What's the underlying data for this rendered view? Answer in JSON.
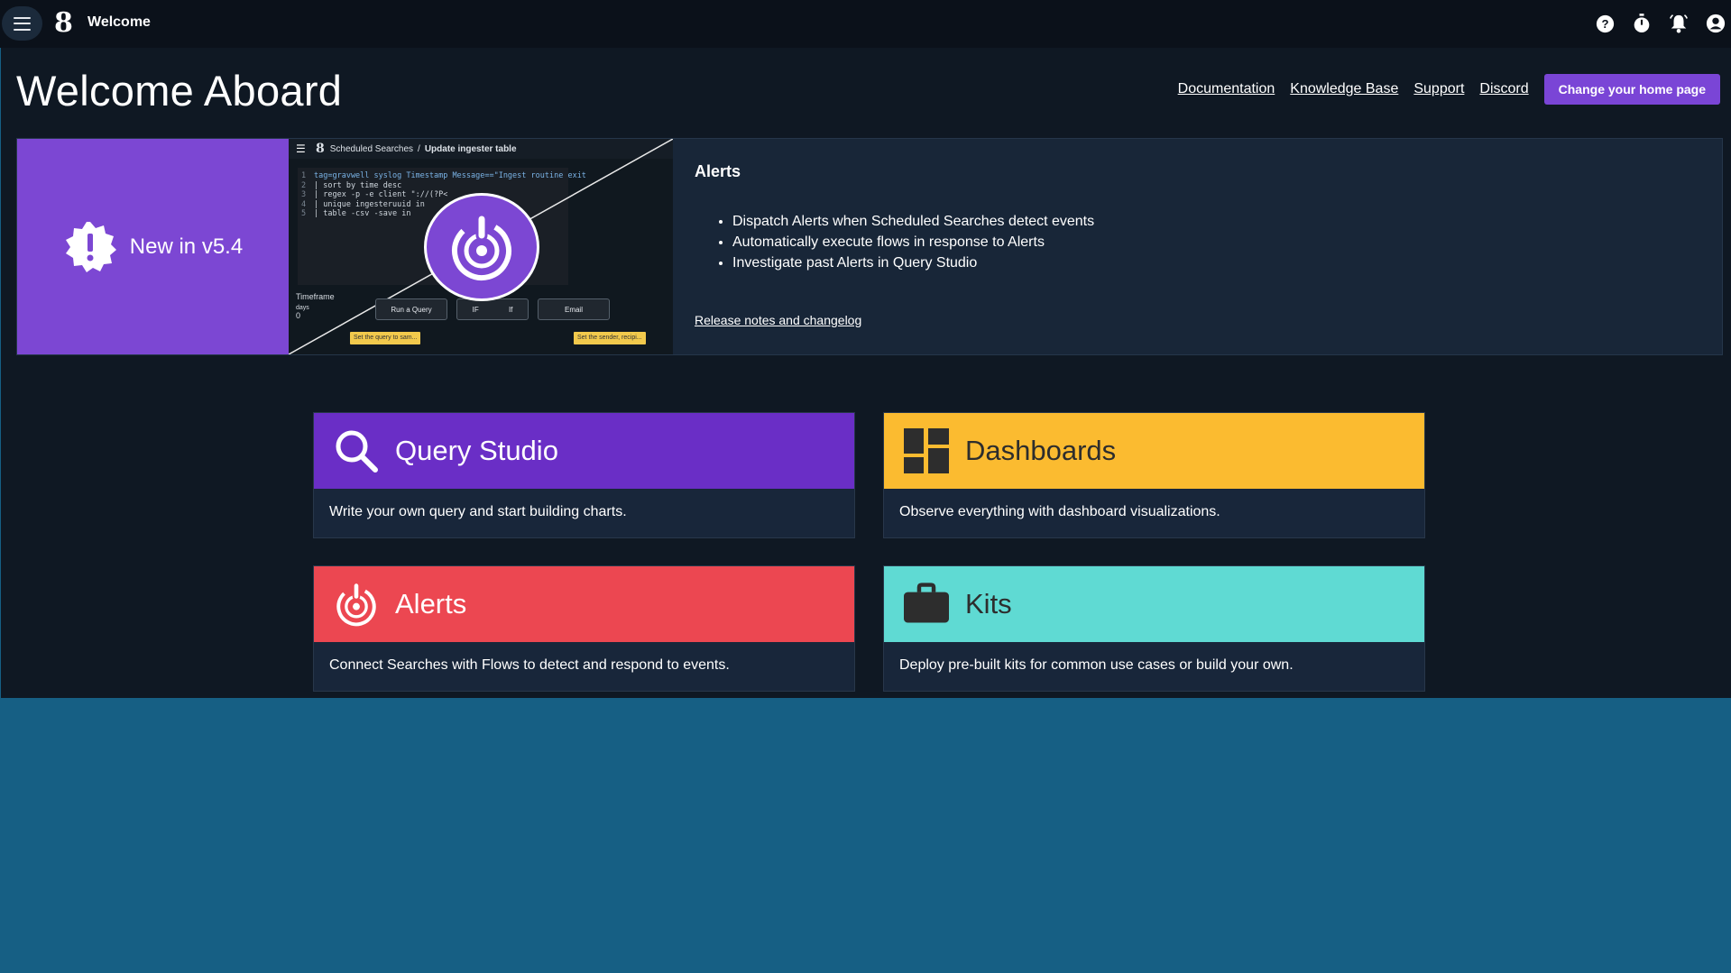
{
  "topbar": {
    "app_title": "Welcome",
    "logo_glyph": "8",
    "icons": [
      "help-icon",
      "timer-icon",
      "notifications-icon",
      "account-icon"
    ]
  },
  "header": {
    "title": "Welcome Aboard",
    "links": [
      "Documentation",
      "Knowledge Base",
      "Support",
      "Discord"
    ],
    "home_button": "Change your home page"
  },
  "banner": {
    "new_label": "New in v5.4",
    "preview": {
      "breadcrumb_parent": "Scheduled Searches",
      "breadcrumb_sep": "/",
      "breadcrumb_current": "Update ingester table",
      "code_lines": [
        "tag=gravwell syslog Timestamp Message==\"Ingest routine exit",
        "| sort by time desc",
        "| regex -p -e client \"://(?P<",
        "| unique ingesteruuid in",
        "| table -csv -save in"
      ],
      "line_numbers": [
        "1",
        "2",
        "3",
        "4",
        "5"
      ],
      "timeframe_label": "Timeframe",
      "days_label": "days",
      "days_value": "0",
      "flow_nodes": [
        "Run a Query",
        "IF",
        "Email"
      ],
      "flow_if_sub": "If",
      "note_left": "Set the query to sam...",
      "note_right": "Set the sender, recipi..."
    },
    "heading": "Alerts",
    "bullets": [
      "Dispatch Alerts when Scheduled Searches detect events",
      "Automatically execute flows in response to Alerts",
      "Investigate past Alerts in Query Studio"
    ],
    "release_link": "Release notes and changelog"
  },
  "cards": [
    {
      "title": "Query Studio",
      "description": "Write your own query and start building charts.",
      "color": "#6a2ec6",
      "icon": "search-icon"
    },
    {
      "title": "Dashboards",
      "description": "Observe everything with dashboard visualizations.",
      "color": "#fbbb30",
      "icon": "dashboard-icon"
    },
    {
      "title": "Alerts",
      "description": "Connect Searches with Flows to detect and respond to events.",
      "color": "#ec4751",
      "icon": "alerts-icon"
    },
    {
      "title": "Kits",
      "description": "Deploy pre-built kits for common use cases or build your own.",
      "color": "#5fdad3",
      "icon": "briefcase-icon"
    }
  ]
}
